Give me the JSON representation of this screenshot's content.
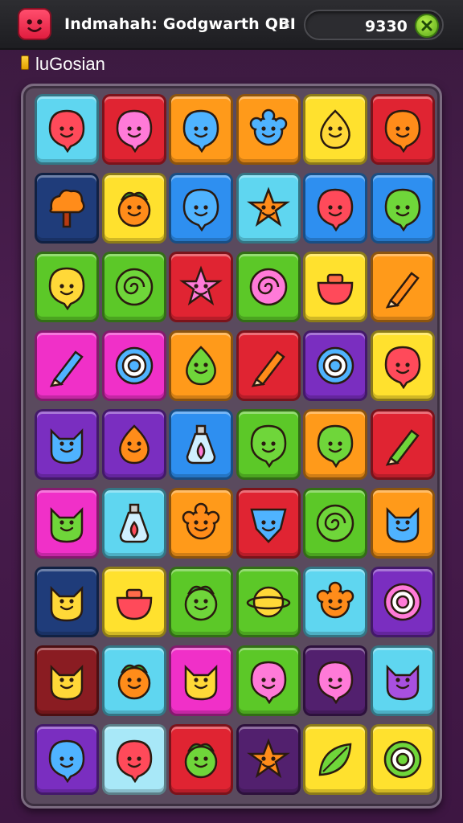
{
  "header": {
    "app_icon": "red-smiley-icon",
    "title": "Indmahah: Godgwarth QBI",
    "close_glyph": "x",
    "score": "9330",
    "score_button_icon": "green-expand-icon"
  },
  "level": {
    "icon": "yellow-bar-icon",
    "label": "luGosian"
  },
  "colors": {
    "cyan": "#5fd6f0",
    "red": "#e02432",
    "orange": "#ff9a1a",
    "yellow": "#ffe12e",
    "green": "#5cc828",
    "navy": "#1f3c7a",
    "blue": "#2e8ff0",
    "magenta": "#f030c8",
    "purple": "#7a2ec0",
    "darkred": "#8a1c22",
    "darkpurple": "#52206e",
    "lightblue": "#a8e8f8"
  },
  "board": {
    "rows": [
      [
        {
          "bg": "cyan",
          "icon": "red-balloon"
        },
        {
          "bg": "red",
          "icon": "pink-balloon"
        },
        {
          "bg": "orange",
          "icon": "blue-blob"
        },
        {
          "bg": "orange",
          "icon": "blue-cloud"
        },
        {
          "bg": "yellow",
          "icon": "yellow-lemon"
        },
        {
          "bg": "red",
          "icon": "orange-fruit"
        }
      ],
      [
        {
          "bg": "navy",
          "icon": "orange-tree"
        },
        {
          "bg": "yellow",
          "icon": "orange-leafy"
        },
        {
          "bg": "blue",
          "icon": "blue-balloon"
        },
        {
          "bg": "cyan",
          "icon": "orange-star"
        },
        {
          "bg": "blue",
          "icon": "red-balloon"
        },
        {
          "bg": "blue",
          "icon": "green-balloon"
        }
      ],
      [
        {
          "bg": "green",
          "icon": "yellow-smiley"
        },
        {
          "bg": "green",
          "icon": "green-swirl"
        },
        {
          "bg": "red",
          "icon": "pink-star"
        },
        {
          "bg": "green",
          "icon": "pink-swirl"
        },
        {
          "bg": "yellow",
          "icon": "red-pot"
        },
        {
          "bg": "orange",
          "icon": "orange-carrot"
        }
      ],
      [
        {
          "bg": "magenta",
          "icon": "blue-crayon"
        },
        {
          "bg": "magenta",
          "icon": "blue-target"
        },
        {
          "bg": "orange",
          "icon": "green-drop"
        },
        {
          "bg": "red",
          "icon": "orange-pencil"
        },
        {
          "bg": "purple",
          "icon": "blue-target"
        },
        {
          "bg": "yellow",
          "icon": "red-ball"
        }
      ],
      [
        {
          "bg": "purple",
          "icon": "blue-cat"
        },
        {
          "bg": "purple",
          "icon": "orange-lemon"
        },
        {
          "bg": "blue",
          "icon": "pink-potion"
        },
        {
          "bg": "green",
          "icon": "green-frog"
        },
        {
          "bg": "orange",
          "icon": "green-blob"
        },
        {
          "bg": "red",
          "icon": "green-carrot"
        }
      ],
      [
        {
          "bg": "magenta",
          "icon": "green-cat"
        },
        {
          "bg": "cyan",
          "icon": "red-potion"
        },
        {
          "bg": "orange",
          "icon": "orange-flower"
        },
        {
          "bg": "red",
          "icon": "blue-shield"
        },
        {
          "bg": "green",
          "icon": "green-swirl"
        },
        {
          "bg": "orange",
          "icon": "blue-cat"
        }
      ],
      [
        {
          "bg": "navy",
          "icon": "yellow-cat"
        },
        {
          "bg": "yellow",
          "icon": "red-pot"
        },
        {
          "bg": "green",
          "icon": "green-cactus"
        },
        {
          "bg": "green",
          "icon": "yellow-planet"
        },
        {
          "bg": "cyan",
          "icon": "orange-sun"
        },
        {
          "bg": "purple",
          "icon": "pink-target"
        }
      ],
      [
        {
          "bg": "darkred",
          "icon": "yellow-cat"
        },
        {
          "bg": "cyan",
          "icon": "orange-acorn"
        },
        {
          "bg": "magenta",
          "icon": "yellow-cat"
        },
        {
          "bg": "green",
          "icon": "pink-balloon"
        },
        {
          "bg": "darkpurple",
          "icon": "pink-balloon"
        },
        {
          "bg": "cyan",
          "icon": "purple-cat"
        }
      ],
      [
        {
          "bg": "purple",
          "icon": "blue-balloon"
        },
        {
          "bg": "lightblue",
          "icon": "red-fruit"
        },
        {
          "bg": "red",
          "icon": "green-cactus"
        },
        {
          "bg": "darkpurple",
          "icon": "orange-star"
        },
        {
          "bg": "yellow",
          "icon": "green-leaf"
        },
        {
          "bg": "yellow",
          "icon": "green-target"
        }
      ]
    ]
  }
}
